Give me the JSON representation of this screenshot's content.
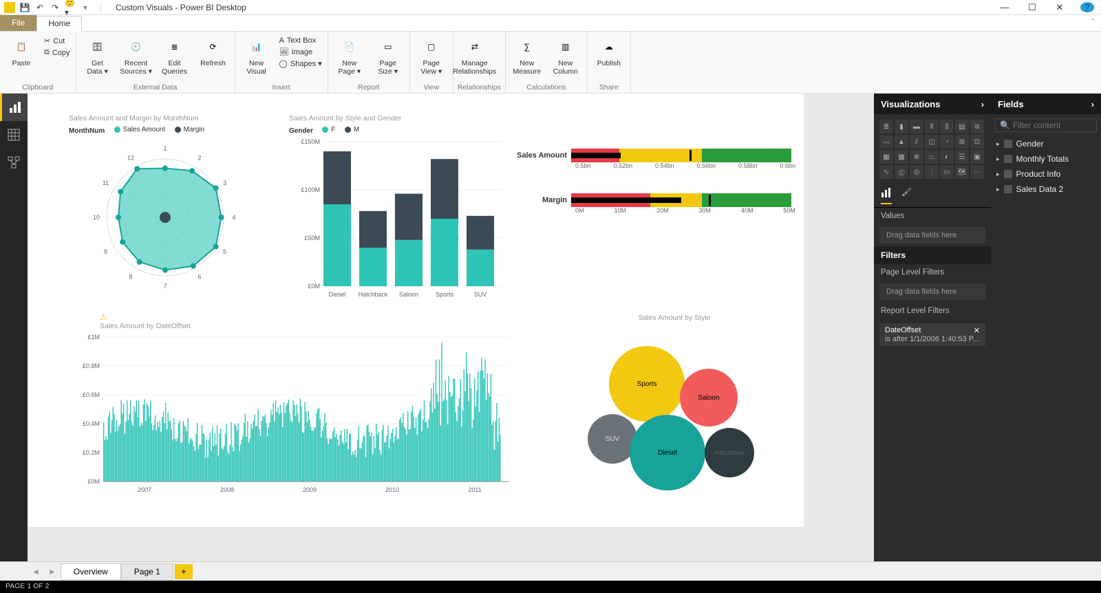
{
  "app": {
    "title": "Custom Visuals - Power BI Desktop"
  },
  "tabs": {
    "file": "File",
    "home": "Home"
  },
  "ribbon": {
    "clipboard": {
      "label": "Clipboard",
      "paste": "Paste",
      "cut": "Cut",
      "copy": "Copy"
    },
    "external": {
      "label": "External Data",
      "get_data": "Get\nData ▾",
      "recent": "Recent\nSources ▾",
      "edit": "Edit\nQueries",
      "refresh": "Refresh"
    },
    "insert": {
      "label": "Insert",
      "new_visual": "New\nVisual",
      "textbox": "Text Box",
      "image": "Image",
      "shapes": "Shapes ▾"
    },
    "report": {
      "label": "Report",
      "new_page": "New\nPage ▾",
      "page_size": "Page\nSize ▾"
    },
    "view": {
      "label": "View",
      "page_view": "Page\nView ▾"
    },
    "relationships": {
      "label": "Relationships",
      "manage": "Manage\nRelationships"
    },
    "calculations": {
      "label": "Calculations",
      "new_measure": "New\nMeasure",
      "new_column": "New\nColumn"
    },
    "share": {
      "label": "Share",
      "publish": "Publish"
    }
  },
  "charts": {
    "radar": {
      "title": "Sales Amount and Margin by MonthNum",
      "legend_dim": "MonthNum",
      "series": [
        {
          "name": "Sales Amount",
          "color": "#2ec4b6"
        },
        {
          "name": "Margin",
          "color": "#3c4a55"
        }
      ],
      "labels": [
        "1",
        "2",
        "3",
        "4",
        "5",
        "6",
        "7",
        "8",
        "9",
        "10",
        "11",
        "12"
      ]
    },
    "bar": {
      "title": "Sales Amount by Style and Gender",
      "legend_dim": "Gender",
      "series": [
        {
          "name": "F",
          "color": "#2ec4b6"
        },
        {
          "name": "M",
          "color": "#3c4a55"
        }
      ],
      "ylabels": [
        "£0M",
        "£50M",
        "£100M",
        "£150M"
      ],
      "categories": [
        "Diesel",
        "Hatchback",
        "Saloon",
        "Sports",
        "SUV"
      ]
    },
    "bullet1": {
      "label": "Sales Amount",
      "ticks": [
        "0.5bn",
        "0.52bn",
        "0.54bn",
        "0.56bn",
        "0.58bn",
        "0.6bn"
      ]
    },
    "bullet2": {
      "label": "Margin",
      "ticks": [
        "0M",
        "10M",
        "20M",
        "30M",
        "40M",
        "50M"
      ]
    },
    "line": {
      "title": "Sales Amount by DateOffset",
      "ylabels": [
        "£0M",
        "£0.2M",
        "£0.4M",
        "£0.6M",
        "£0.8M",
        "£1M"
      ],
      "xlabels": [
        "2007",
        "2008",
        "2009",
        "2010",
        "2011"
      ]
    },
    "bubble": {
      "title": "Sales Amount by Style",
      "items": [
        {
          "name": "Sports",
          "color": "#f2c811"
        },
        {
          "name": "Saloon",
          "color": "#f15b5b"
        },
        {
          "name": "SUV",
          "color": "#6b7278"
        },
        {
          "name": "Diesel",
          "color": "#17a398"
        },
        {
          "name": "Hatchback",
          "color": "#2e3b3f"
        }
      ]
    }
  },
  "chart_data": [
    {
      "type": "radar",
      "title": "Sales Amount and Margin by MonthNum",
      "categories": [
        "1",
        "2",
        "3",
        "4",
        "5",
        "6",
        "7",
        "8",
        "9",
        "10",
        "11",
        "12"
      ],
      "series": [
        {
          "name": "Sales Amount",
          "values": [
            42,
            46,
            50,
            48,
            50,
            48,
            45,
            44,
            42,
            40,
            44,
            48
          ]
        },
        {
          "name": "Margin",
          "values": [
            4,
            4,
            4,
            4,
            4,
            4,
            4,
            4,
            4,
            4,
            4,
            4
          ]
        }
      ],
      "note": "relative radius estimates; inner Margin series collapses to center"
    },
    {
      "type": "bar",
      "title": "Sales Amount by Style and Gender",
      "stacked": true,
      "categories": [
        "Diesel",
        "Hatchback",
        "Saloon",
        "Sports",
        "SUV"
      ],
      "series": [
        {
          "name": "F",
          "values": [
            85,
            40,
            48,
            70,
            38
          ]
        },
        {
          "name": "M",
          "values": [
            55,
            38,
            48,
            62,
            35
          ]
        }
      ],
      "ylabel": "£M",
      "ylim": [
        0,
        150
      ]
    },
    {
      "type": "bullet",
      "title": "Sales Amount",
      "ranges": [
        0.5,
        0.52,
        0.56,
        0.6
      ],
      "actual": 0.514,
      "target": 0.555,
      "unit": "bn"
    },
    {
      "type": "bullet",
      "title": "Margin",
      "ranges": [
        0,
        18,
        30,
        50
      ],
      "actual": 25,
      "target": 31,
      "unit": "M"
    },
    {
      "type": "line",
      "title": "Sales Amount by DateOffset",
      "xlabel": "",
      "ylabel": "£M",
      "ylim": [
        0,
        1
      ],
      "x_range": [
        "2007",
        "2011"
      ],
      "note": "dense daily series ~0.1–0.8M, spiking near 1M in 2011"
    },
    {
      "type": "bubble",
      "title": "Sales Amount by Style",
      "items": [
        {
          "name": "Sports",
          "value": 140
        },
        {
          "name": "Saloon",
          "value": 95
        },
        {
          "name": "Diesel",
          "value": 140
        },
        {
          "name": "SUV",
          "value": 75
        },
        {
          "name": "Hatchback",
          "value": 70
        }
      ],
      "note": "value ≈ relative bubble area estimate"
    }
  ],
  "vis_pane": {
    "title": "Visualizations",
    "values": "Values",
    "drag": "Drag data fields here",
    "filters_hdr": "Filters",
    "page_filters": "Page Level Filters",
    "report_filters": "Report Level Filters",
    "filter_field": "DateOffset",
    "filter_desc": "is after 1/1/2006 1:40:53 P..."
  },
  "fields_pane": {
    "title": "Fields",
    "search_ph": "Filter content",
    "tables": [
      "Gender",
      "Monthly Totals",
      "Product Info",
      "Sales Data 2"
    ]
  },
  "pages": {
    "tab1": "Overview",
    "tab2": "Page 1"
  },
  "status": "PAGE 1 OF 2"
}
